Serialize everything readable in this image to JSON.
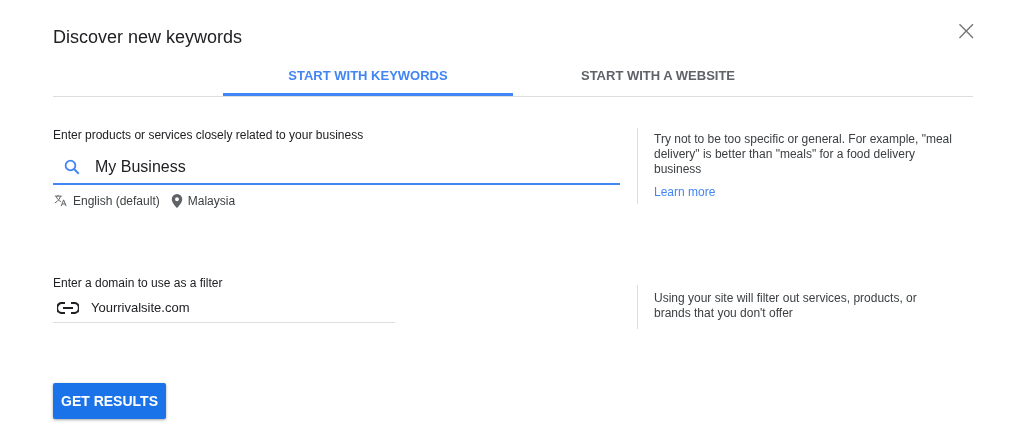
{
  "dialog": {
    "title": "Discover new keywords",
    "close": "×"
  },
  "tabs": [
    {
      "label": "START WITH KEYWORDS",
      "selected": true
    },
    {
      "label": "START WITH A WEBSITE",
      "selected": false
    }
  ],
  "keywords": {
    "label": "Enter products or services closely related to your business",
    "value": "My Business",
    "language": "English (default)",
    "location": "Malaysia",
    "tip": "Try not to be too specific or general. For example, \"meal delivery\" is better than \"meals\" for a food delivery business",
    "link": "Learn more"
  },
  "domain": {
    "label": "Enter a domain to use as a filter",
    "value": "Yourrivalsite.com",
    "tip": "Using your site will filter out services, products, or brands that you don't offer"
  },
  "button": "GET RESULTS"
}
